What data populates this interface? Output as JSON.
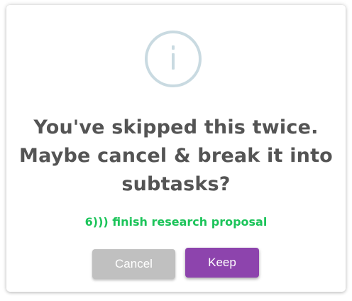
{
  "dialog": {
    "icon": "info-icon",
    "title": "You've skipped this twice. Maybe cancel & break it into subtasks?",
    "task_text": "6))) finish research proposal",
    "cancel_label": "Cancel",
    "keep_label": "Keep"
  },
  "colors": {
    "icon": "#c9dae1",
    "title": "#545454",
    "task": "#1cc45a",
    "cancel_button": "#c0c0c0",
    "keep_button": "#8d44ad"
  }
}
